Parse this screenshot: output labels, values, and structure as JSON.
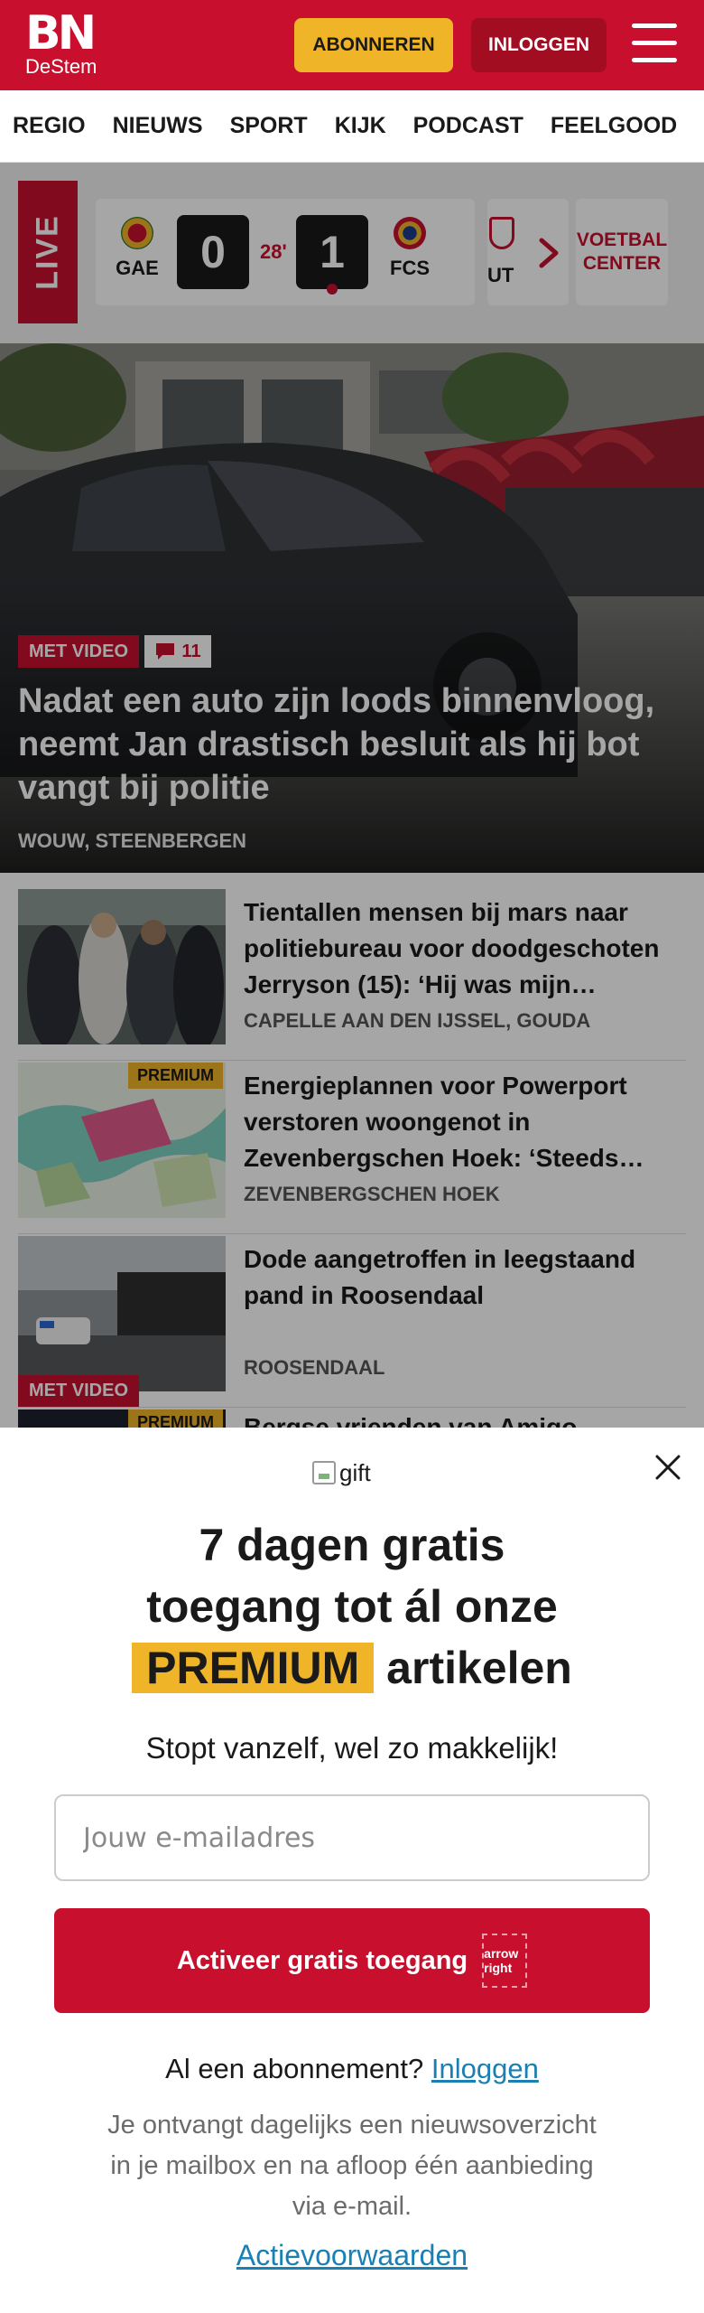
{
  "header": {
    "logo_main": "BN",
    "logo_sub": "DeStem",
    "subscribe_label": "ABONNEREN",
    "login_label": "INLOGGEN"
  },
  "nav": {
    "items": [
      "REGIO",
      "NIEUWS",
      "SPORT",
      "KIJK",
      "PODCAST",
      "FEELGOOD"
    ]
  },
  "live": {
    "label": "LIVE",
    "match": {
      "home_team": "GAE",
      "home_score": "0",
      "minute": "28'",
      "away_score": "1",
      "away_team": "FCS"
    },
    "next_team": "UT",
    "voetbal_center_label": "VOETBAL CENTER"
  },
  "hero": {
    "badge_video": "MET VIDEO",
    "comment_count": "11",
    "title": "Nadat een auto zijn loods binnen­vloog, neemt Jan drastisch besluit als hij bot vangt bij politie",
    "location": "WOUW, STEENBERGEN"
  },
  "articles": [
    {
      "title": "Tientallen mensen bij mars naar politiebureau voor doodgescho­ten Jerryson (15): ‘Hij was mijn…",
      "location": "CAPELLE AAN DEN IJSSEL, GOUDA",
      "premium": false,
      "video": false
    },
    {
      "title": "Energieplannen voor Powerport verstoren woongenot in Zevenbergschen Hoek: ‘Steeds…",
      "location": "ZEVENBERGSCHEN HOEK",
      "premium": true,
      "video": false
    },
    {
      "title": "Dode aangetroffen in leegstaand pand in Roosendaal",
      "location": "ROOSENDAAL",
      "premium": false,
      "video": true
    },
    {
      "title": "Bergse vrienden van Amigo",
      "location": "",
      "premium": true,
      "video": false
    }
  ],
  "badges": {
    "premium": "PREMIUM",
    "video": "MET VIDEO"
  },
  "paywall": {
    "gift_alt": "gift",
    "title_line1": "7 dagen gratis",
    "title_line2": "toegang tot ál onze",
    "title_premium": "PREMIUM",
    "title_end": "artikelen",
    "subtitle": "Stopt vanzelf, wel zo makkelijk!",
    "email_placeholder": "Jouw e-mailadres",
    "email_value": "",
    "cta_label": "Activeer gratis toegang",
    "cta_icon_alt": "arrow right",
    "have_sub_text": "Al een abonnement?",
    "have_sub_link": "Inloggen",
    "disclaimer": "Je ontvangt dagelijks een nieuwsoverzicht in je mailbox en na afloop één aanbieding via e-mail.",
    "terms_link": "Actievoorwaarden"
  },
  "colors": {
    "brand_red": "#c8102e",
    "premium_yellow": "#f0b429",
    "link_blue": "#1a7fb3"
  }
}
